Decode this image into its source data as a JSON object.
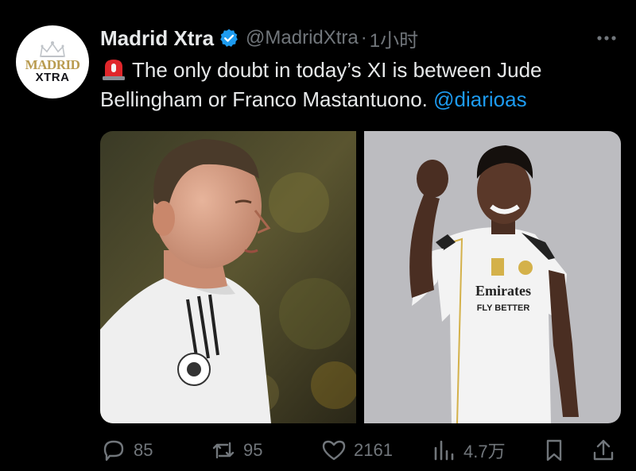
{
  "account": {
    "display_name": "Madrid Xtra",
    "handle": "@MadridXtra",
    "separator": "·",
    "time": "1小时",
    "avatar_line1": "MADRID",
    "avatar_line2": "XTRA"
  },
  "tweet": {
    "text": "The only doubt in today’s XI is between Jude Bellingham or Franco Mastantuono.",
    "mention": "@diarioas"
  },
  "metrics": {
    "replies": "85",
    "retweets": "95",
    "likes": "2161",
    "views": "4.7万"
  },
  "colors": {
    "background": "#000000",
    "text": "#e7e9ea",
    "muted": "#71767b",
    "link": "#1d9bf0",
    "verified": "#1d9bf0",
    "siren": "#e0262b"
  },
  "icons": {
    "verified": "verified-badge-icon",
    "more": "more-dots-icon",
    "siren": "siren-emoji-icon",
    "reply": "reply-icon",
    "retweet": "retweet-icon",
    "like": "heart-icon",
    "views": "views-bar-icon",
    "bookmark": "bookmark-icon",
    "share": "share-icon"
  }
}
